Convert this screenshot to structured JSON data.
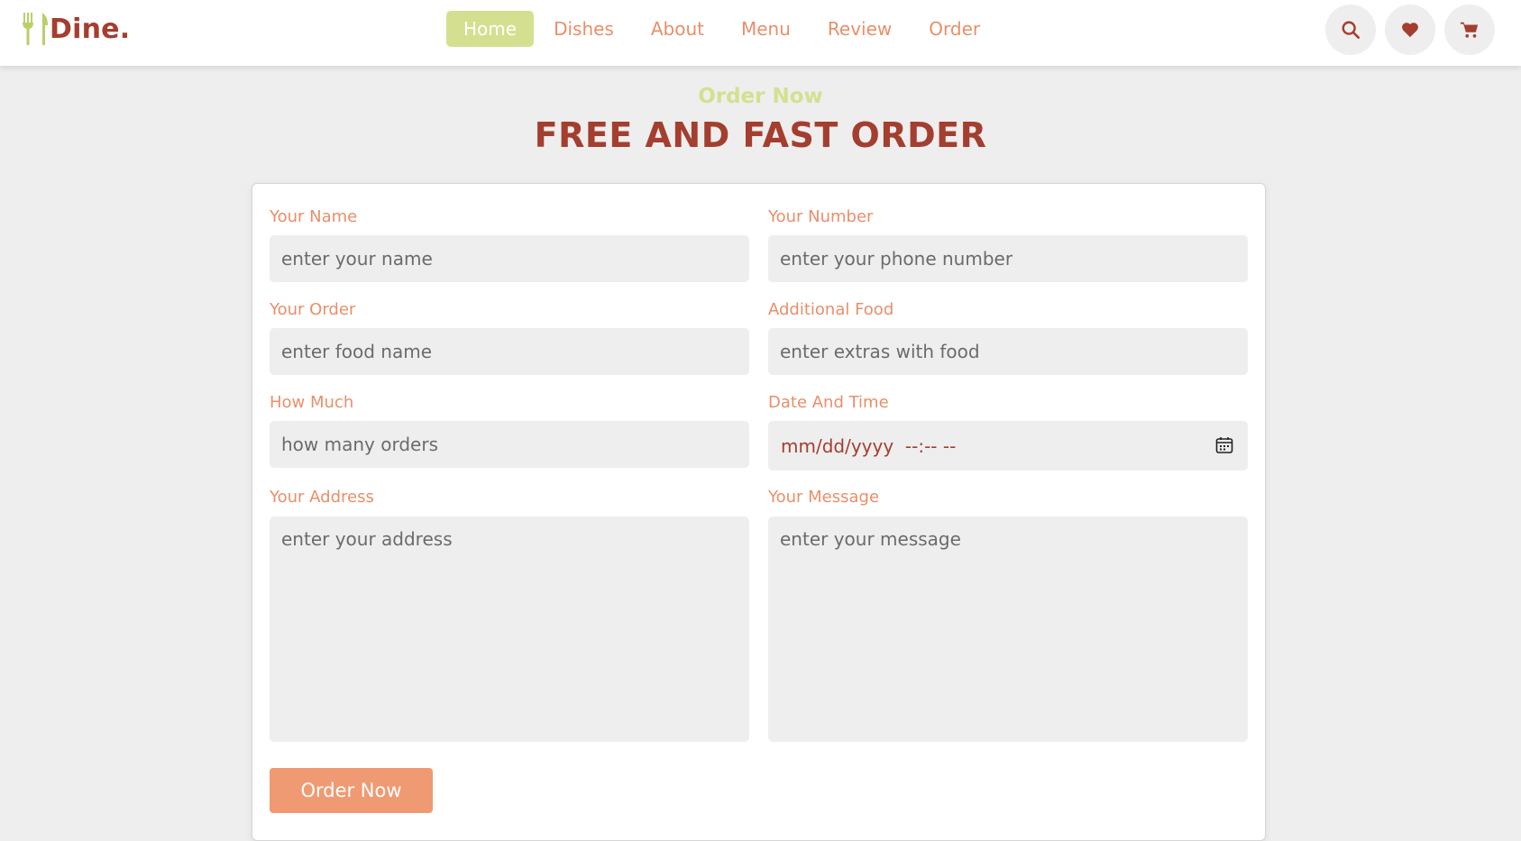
{
  "brand": {
    "name": "Dine.",
    "icon": "utensils-icon"
  },
  "nav": {
    "items": [
      {
        "label": "Home",
        "active": true
      },
      {
        "label": "Dishes",
        "active": false
      },
      {
        "label": "About",
        "active": false
      },
      {
        "label": "Menu",
        "active": false
      },
      {
        "label": "Review",
        "active": false
      },
      {
        "label": "Order",
        "active": false
      }
    ]
  },
  "header_icons": [
    "search-icon",
    "heart-icon",
    "cart-icon"
  ],
  "section": {
    "subtitle": "Order Now",
    "title": "FREE AND FAST ORDER"
  },
  "form": {
    "name": {
      "label": "Your Name",
      "placeholder": "enter your name"
    },
    "number": {
      "label": "Your Number",
      "placeholder": "enter your phone number"
    },
    "order": {
      "label": "Your Order",
      "placeholder": "enter food name"
    },
    "additional": {
      "label": "Additional Food",
      "placeholder": "enter extras with food"
    },
    "quantity": {
      "label": "How Much",
      "placeholder": "how many orders"
    },
    "datetime": {
      "label": "Date And Time",
      "placeholder": "mm/dd/yyyy  --:-- --"
    },
    "address": {
      "label": "Your Address",
      "placeholder": "enter your address"
    },
    "message": {
      "label": "Your Message",
      "placeholder": "enter your message"
    },
    "submit_label": "Order Now"
  },
  "colors": {
    "brand": "#a43e2f",
    "accent_green": "#d4e08f",
    "accent_orange": "#e88f6a",
    "button": "#f09a73",
    "background": "#eeeeee"
  }
}
